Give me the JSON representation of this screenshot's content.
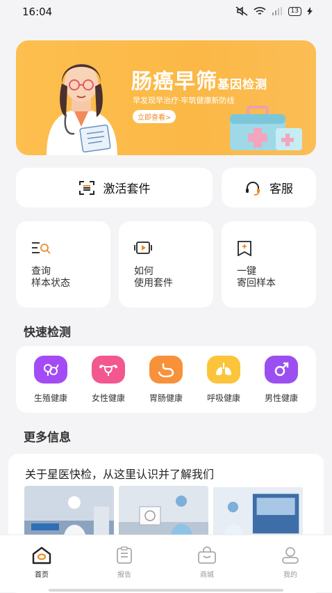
{
  "status_bar": {
    "time": "16:04",
    "battery": "13"
  },
  "banner": {
    "title": "肠癌早筛",
    "title_suffix": "基因检测",
    "subtitle": "早发现早治疗·牢筑健康新防线",
    "button": "立即查看>"
  },
  "actions": {
    "activate": "激活套件",
    "service": "客服"
  },
  "features": [
    {
      "line1": "查询",
      "line2": "样本状态"
    },
    {
      "line1": "如何",
      "line2": "使用套件"
    },
    {
      "line1": "一键",
      "line2": "寄回样本"
    }
  ],
  "quick_section": {
    "title": "快速检测"
  },
  "quick_items": [
    {
      "label": "生殖健康",
      "color": "#a34cf5"
    },
    {
      "label": "女性健康",
      "color": "#f3578f"
    },
    {
      "label": "胃肠健康",
      "color": "#f7913a"
    },
    {
      "label": "呼吸健康",
      "color": "#fbc43a"
    },
    {
      "label": "男性健康",
      "color": "#9c4ff0"
    }
  ],
  "more_section": {
    "title": "更多信息",
    "card_title": "关于星医快检，从这里认识并了解我们"
  },
  "tabs": [
    {
      "label": "首页",
      "icon": "home-icon",
      "active": true
    },
    {
      "label": "报告",
      "icon": "report-icon",
      "active": false
    },
    {
      "label": "商城",
      "icon": "shop-icon",
      "active": false
    },
    {
      "label": "我的",
      "icon": "profile-icon",
      "active": false
    }
  ],
  "colors": {
    "accent": "#fbb846",
    "orange_icon": "#f08a24"
  }
}
